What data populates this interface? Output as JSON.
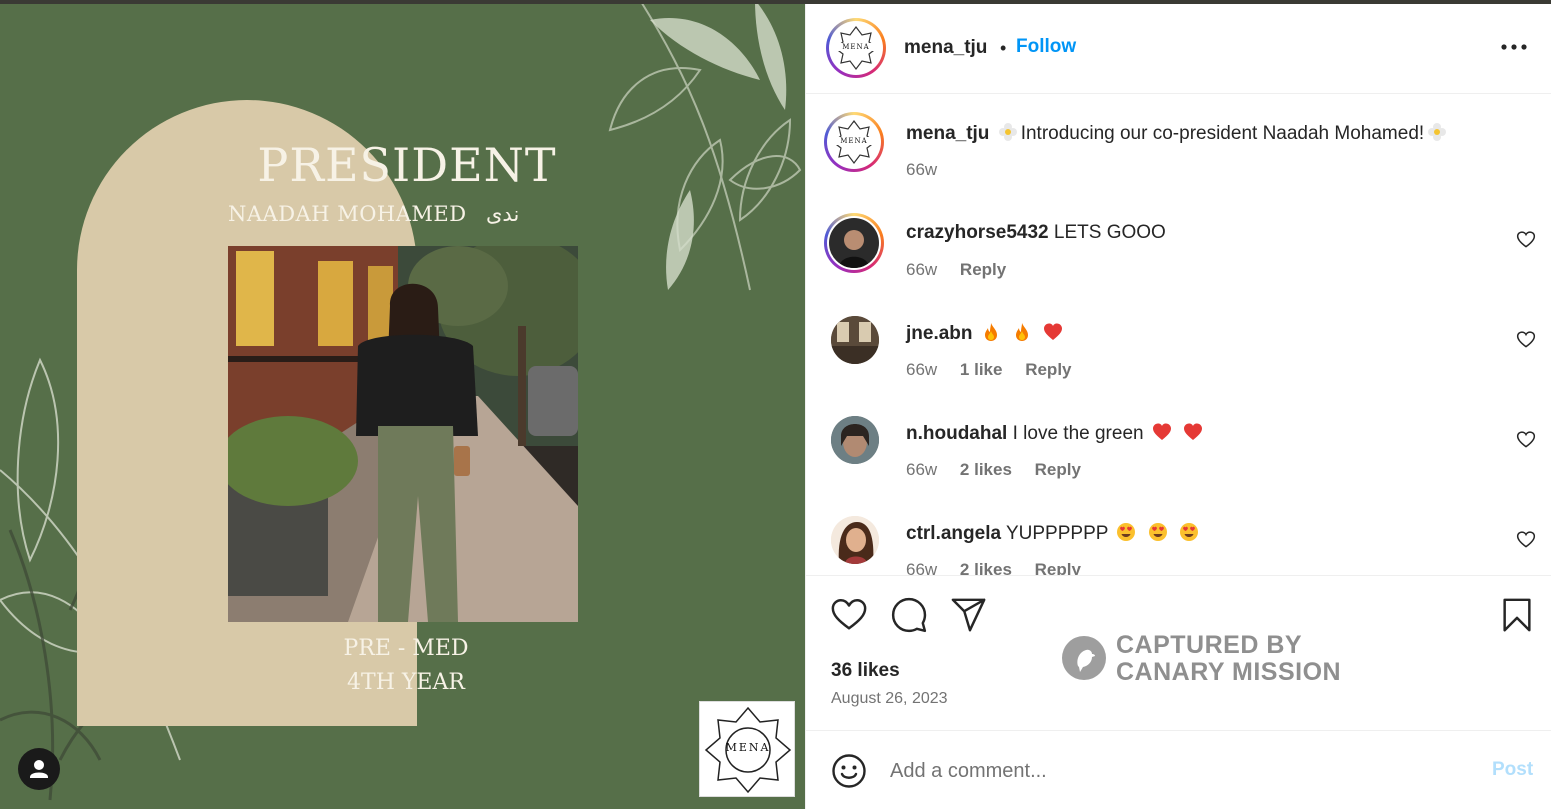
{
  "post_image": {
    "title": "PRESIDENT",
    "name": "NAADAH MOHAMED",
    "arabic_name": "ندى",
    "major": "PRE - MED",
    "year": "4TH YEAR",
    "logo_text": "MENA",
    "colors": {
      "background": "#566f49",
      "arch": "#d8c9a8",
      "text": "#f7f2e6"
    }
  },
  "header": {
    "username": "mena_tju",
    "separator": "•",
    "follow_label": "Follow",
    "more_icon": "more-horizontal-icon",
    "avatar_text": "MENA"
  },
  "caption": {
    "username": "mena_tju",
    "text": "Introducing our co-president Naadah Mohamed!",
    "emoji": "flower-emoji",
    "age": "66w"
  },
  "comments": [
    {
      "username": "crazyhorse5432",
      "text": "LETS GOOO",
      "emojis": [],
      "age": "66w",
      "likes": "",
      "reply": "Reply"
    },
    {
      "username": "jne.abn",
      "text": "",
      "emojis": [
        "fire",
        "fire",
        "red-heart"
      ],
      "age": "66w",
      "likes": "1 like",
      "reply": "Reply"
    },
    {
      "username": "n.houdahal",
      "text": "I love the green",
      "emojis": [
        "red-heart",
        "red-heart"
      ],
      "age": "66w",
      "likes": "2 likes",
      "reply": "Reply"
    },
    {
      "username": "ctrl.angela",
      "text": "YUPPPPPP",
      "emojis": [
        "heart-eyes",
        "heart-eyes",
        "heart-eyes"
      ],
      "age": "66w",
      "likes": "2 likes",
      "reply": "Reply"
    }
  ],
  "actions": {
    "likes": "36 likes",
    "date": "August 26, 2023",
    "icons": [
      "heart-icon",
      "comment-icon",
      "share-icon",
      "bookmark-icon"
    ]
  },
  "watermark": {
    "line1": "CAPTURED BY",
    "line2": "CANARY MISSION"
  },
  "add_comment": {
    "placeholder": "Add a comment...",
    "post_label": "Post",
    "emoji_icon": "smiley-icon"
  },
  "colors": {
    "accent": "#0095f6",
    "muted": "#737373",
    "post_disabled": "#b2dffc",
    "red_heart": "#ed4956"
  }
}
